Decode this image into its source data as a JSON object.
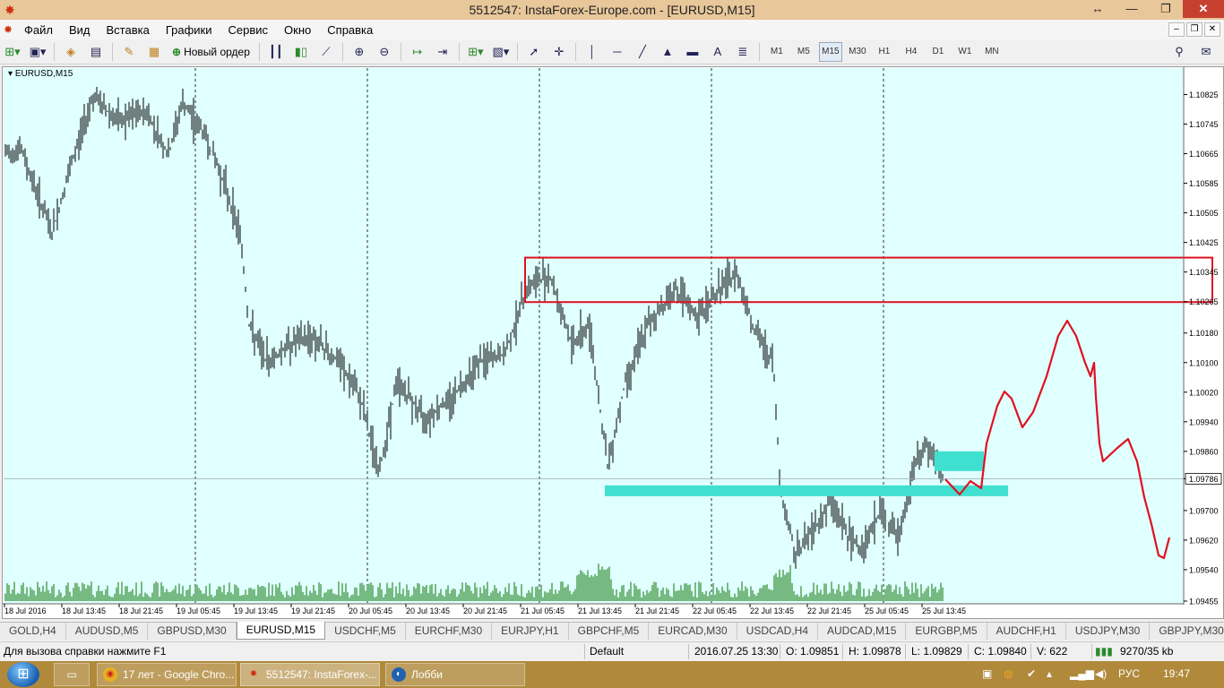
{
  "window": {
    "title": "5512547: InstaForex-Europe.com - [EURUSD,M15]",
    "min_label": "—",
    "max_label": "❐",
    "close_label": "✕",
    "nav_arrows": "↔"
  },
  "menu": {
    "items": [
      "Файл",
      "Вид",
      "Вставка",
      "Графики",
      "Сервис",
      "Окно",
      "Справка"
    ]
  },
  "toolbar": {
    "new_order_label": "Новый ордер",
    "timeframes": [
      "M1",
      "M5",
      "M15",
      "M30",
      "H1",
      "H4",
      "D1",
      "W1",
      "MN"
    ],
    "active_timeframe": "M15",
    "text_tool": "A"
  },
  "chart": {
    "symbol_label": "EURUSD,M15",
    "price_labels": [
      "1.10825",
      "1.10745",
      "1.10665",
      "1.10585",
      "1.10505",
      "1.10425",
      "1.10345",
      "1.10265",
      "1.10180",
      "1.10100",
      "1.10020",
      "1.09940",
      "1.09860",
      "1.09786",
      "1.09700",
      "1.09620",
      "1.09540",
      "1.09455"
    ],
    "current_price": "1.09786",
    "time_labels": [
      "18 Jul 2016",
      "18 Jul 13:45",
      "18 Jul 21:45",
      "19 Jul 05:45",
      "19 Jul 13:45",
      "19 Jul 21:45",
      "20 Jul 05:45",
      "20 Jul 13:45",
      "20 Jul 21:45",
      "21 Jul 05:45",
      "21 Jul 13:45",
      "21 Jul 21:45",
      "22 Jul 05:45",
      "22 Jul 13:45",
      "22 Jul 21:45",
      "25 Jul 05:45",
      "25 Jul 13:45"
    ],
    "colors": {
      "background": "#e0ffff",
      "candles": "#000000",
      "volume": "#2e8b2e",
      "resistance_box": "#e01020",
      "support_zone": "#40e0d0",
      "forecast_line": "#e01020"
    },
    "resistance_zone": [
      1.103,
      1.1035
    ],
    "support_zone": [
      1.0976,
      1.0978
    ],
    "price_range": [
      1.09455,
      1.10865
    ]
  },
  "tabs": {
    "items": [
      "GOLD,H4",
      "AUDUSD,M5",
      "GBPUSD,M30",
      "EURUSD,M15",
      "USDCHF,M5",
      "EURCHF,M30",
      "EURJPY,H1",
      "GBPCHF,M5",
      "EURCAD,M30",
      "USDCAD,H4",
      "AUDCAD,M15",
      "EURGBP,M5",
      "AUDCHF,H1",
      "USDJPY,M30",
      "GBPJPY,M30"
    ],
    "active": "EURUSD,M15"
  },
  "status": {
    "help": "Для вызова справки нажмите F1",
    "profile": "Default",
    "datetime": "2016.07.25 13:30",
    "open": "O: 1.09851",
    "high": "H: 1.09878",
    "low": "L: 1.09829",
    "close": "C: 1.09840",
    "volume": "V: 622",
    "traffic": "9270/35 kb"
  },
  "taskbar": {
    "start_glyph": "⊞",
    "buttons": [
      "17 лет - Google Chro...",
      "5512547: InstaForex-...",
      "Лобби"
    ],
    "lang": "РУС",
    "time": "19:47"
  }
}
